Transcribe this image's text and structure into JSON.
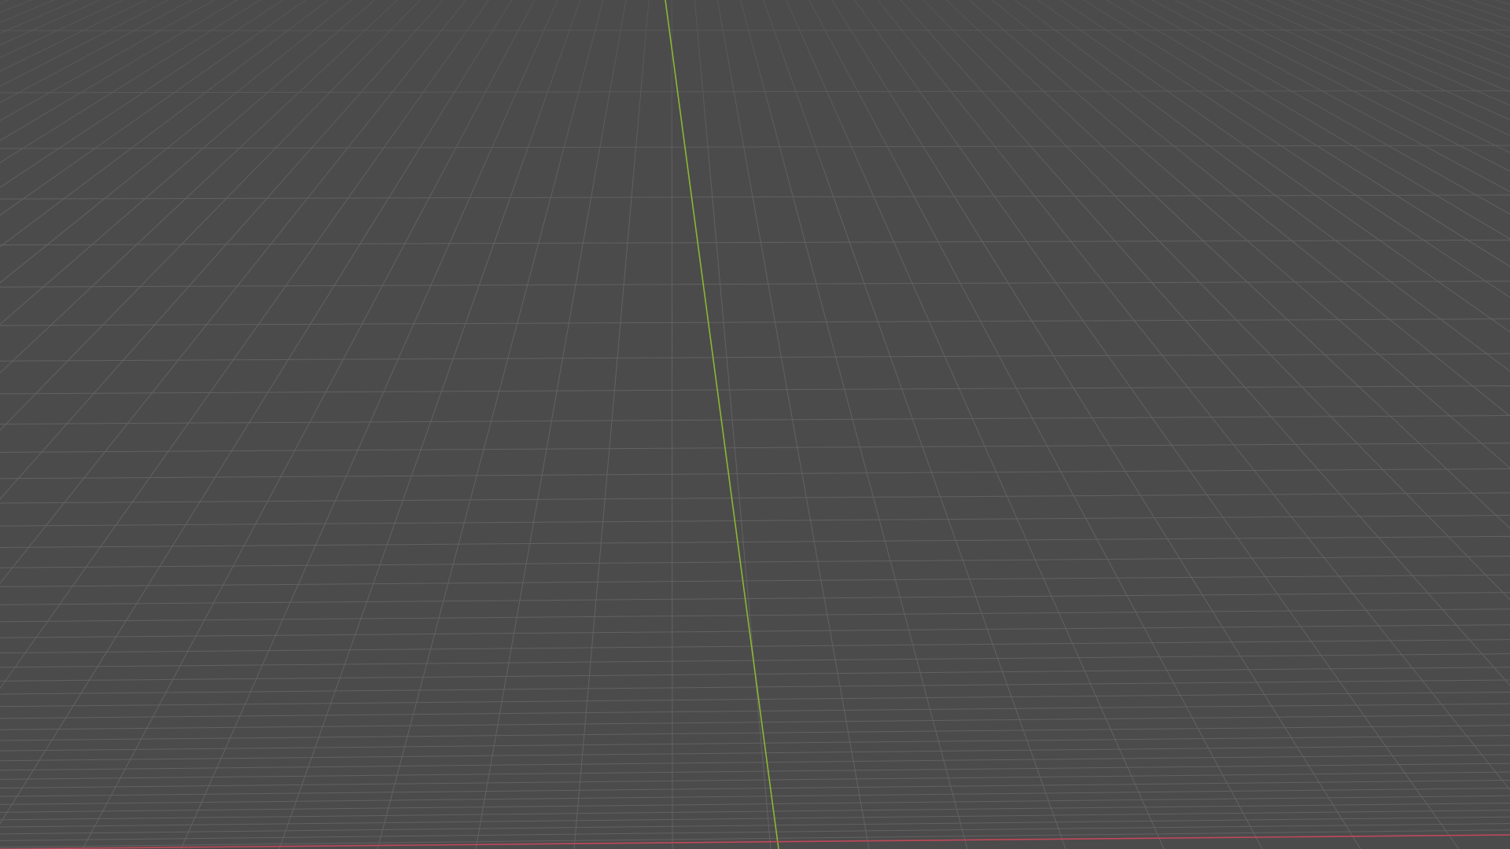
{
  "viewport": {
    "background": "#4b4b4b",
    "grid_color": "#626262",
    "axis_x_color": "#c0485a",
    "axis_y_color": "#8ab832",
    "mesh_fill": "#3c3c3c",
    "mesh_wire": "#202020",
    "shading": "wireframe-on-solid"
  },
  "object": {
    "icon": "character-mesh-icon"
  }
}
